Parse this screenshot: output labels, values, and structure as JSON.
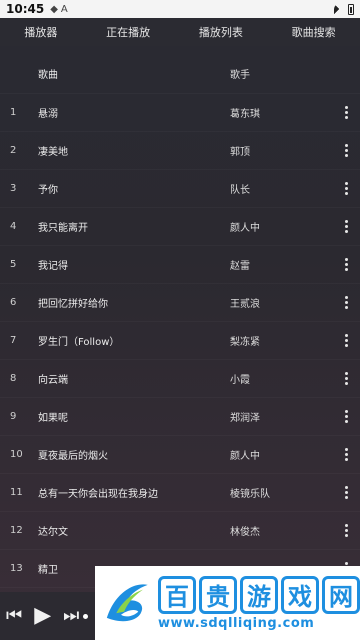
{
  "status": {
    "time": "10:45",
    "icons": [
      "shield-icon",
      "text-icon",
      "wifi-icon",
      "battery-icon"
    ]
  },
  "tabs": [
    {
      "label": "播放器"
    },
    {
      "label": "正在播放"
    },
    {
      "label": "播放列表"
    },
    {
      "label": "歌曲搜索"
    }
  ],
  "list": {
    "header": {
      "title": "歌曲",
      "artist": "歌手"
    },
    "rows": [
      {
        "num": "1",
        "title": "悬溺",
        "artist": "葛东琪"
      },
      {
        "num": "2",
        "title": "凄美地",
        "artist": "郭顶"
      },
      {
        "num": "3",
        "title": "予你",
        "artist": "队长"
      },
      {
        "num": "4",
        "title": "我只能离开",
        "artist": "颜人中"
      },
      {
        "num": "5",
        "title": "我记得",
        "artist": "赵雷"
      },
      {
        "num": "6",
        "title": "把回忆拼好给你",
        "artist": "王贰浪"
      },
      {
        "num": "7",
        "title": "罗生门（Follow）",
        "artist": "梨冻紧"
      },
      {
        "num": "8",
        "title": "向云端",
        "artist": "小霞"
      },
      {
        "num": "9",
        "title": "如果呢",
        "artist": "郑润泽"
      },
      {
        "num": "10",
        "title": "夏夜最后的烟火",
        "artist": "颜人中"
      },
      {
        "num": "11",
        "title": "总有一天你会出现在我身边",
        "artist": "棱镜乐队"
      },
      {
        "num": "12",
        "title": "达尔文",
        "artist": "林俊杰"
      },
      {
        "num": "13",
        "title": "精卫",
        "artist": ""
      }
    ]
  },
  "player": {
    "icons": [
      "previous-icon",
      "play-icon",
      "next-icon"
    ]
  },
  "watermark": {
    "chars": [
      "百",
      "贵",
      "游",
      "戏",
      "网"
    ],
    "url": "www.sdqlliqing.com",
    "color": "#1e8fe0"
  }
}
